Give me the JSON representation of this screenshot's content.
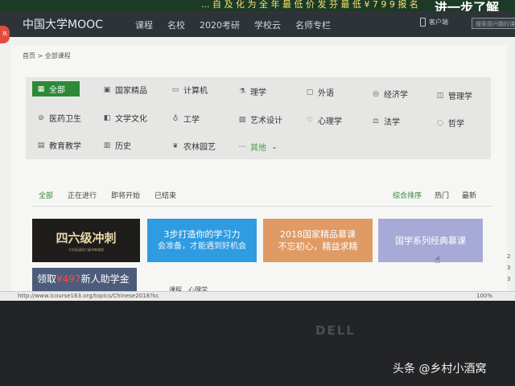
{
  "promo": {
    "text": "... 自 及 化 为 全 年 最 低 价   发 芬 最 低 ¥ 7 9 9 报 名",
    "cta": "进一步了解"
  },
  "header": {
    "logo": "中国大学MOOC",
    "nav": [
      "课程",
      "名校",
      "2020考研",
      "学校云",
      "名师专栏"
    ],
    "app_label": "客户端",
    "search_placeholder": "搜索感兴趣的课程"
  },
  "breadcrumb": "首页 > 全部课程",
  "side_badge": "热",
  "categories": [
    {
      "label": "全部",
      "icon": "grid"
    },
    {
      "label": "国家精品",
      "icon": "award"
    },
    {
      "label": "计算机",
      "icon": "monitor"
    },
    {
      "label": "理学",
      "icon": "flask"
    },
    {
      "label": "外语",
      "icon": "chat"
    },
    {
      "label": "经济学",
      "icon": "coin"
    },
    {
      "label": "管理学",
      "icon": "briefcase"
    },
    {
      "label": "医药卫生",
      "icon": "pill"
    },
    {
      "label": "文学文化",
      "icon": "book"
    },
    {
      "label": "工学",
      "icon": "bulb"
    },
    {
      "label": "艺术设计",
      "icon": "image"
    },
    {
      "label": "心理学",
      "icon": "heart"
    },
    {
      "label": "法学",
      "icon": "scales"
    },
    {
      "label": "哲学",
      "icon": "thought"
    },
    {
      "label": "教育教学",
      "icon": "teach"
    },
    {
      "label": "历史",
      "icon": "history"
    },
    {
      "label": "农林园艺",
      "icon": "leaf"
    },
    {
      "label": "其他",
      "icon": "dots"
    }
  ],
  "filters": {
    "status": [
      "全部",
      "正在进行",
      "即将开始",
      "已结束"
    ],
    "sort": [
      "综合排序",
      "热门",
      "最新"
    ]
  },
  "banners": {
    "b1_title": "四六级冲刺",
    "b1_sub": "大学英语四六级冲刺课程",
    "b2_line1": "3步打造你的学习力",
    "b2_line2": "会准备，才能遇到好机会",
    "b3_line1": "2018国家精品慕课",
    "b3_line2": "不忘初心，精益求精",
    "b4_text": "国学系列经典慕课",
    "b5_prefix": "领取",
    "b5_amount": "¥497",
    "b5_suffix": "新人助学金",
    "peek": "课程…心理学"
  },
  "right_edge_numbers": [
    "2",
    "3",
    "3"
  ],
  "status_bar": {
    "url": "http://www.icourse163.org/topics/Chinese2018?kc",
    "zoom": "100%"
  },
  "bezel": {
    "brand": "DELL",
    "watermark": "头条 @乡村小酒窝"
  },
  "colors": {
    "accent": "#2c8a37",
    "header": "#2e3338"
  }
}
